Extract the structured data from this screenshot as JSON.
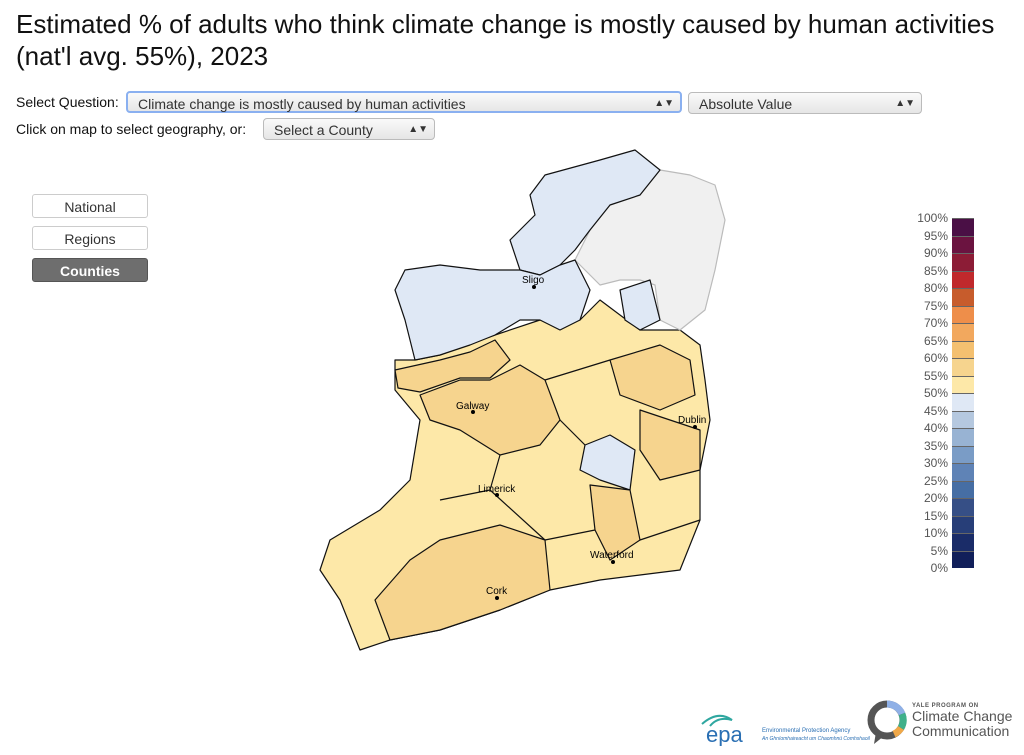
{
  "title": "Estimated % of adults who think climate change is mostly caused by human activities (nat'l avg. 55%), 2023",
  "controls": {
    "question_label": "Select Question:",
    "question_value": "Climate change is mostly caused by human activities",
    "measure_value": "Absolute Value",
    "geo_label": "Click on map to select geography, or:",
    "county_value": "Select a County"
  },
  "levels": [
    {
      "label": "National",
      "active": false
    },
    {
      "label": "Regions",
      "active": false
    },
    {
      "label": "Counties",
      "active": true
    }
  ],
  "legend": {
    "labels": [
      "100%",
      "95%",
      "90%",
      "85%",
      "80%",
      "75%",
      "70%",
      "65%",
      "60%",
      "55%",
      "50%",
      "45%",
      "40%",
      "35%",
      "30%",
      "25%",
      "20%",
      "15%",
      "10%",
      "5%",
      "0%"
    ],
    "colors": [
      "#4a0f45",
      "#6b1340",
      "#8c1c36",
      "#c0292c",
      "#c75c2c",
      "#ee8e4a",
      "#f2a85e",
      "#f4c070",
      "#f6d48e",
      "#fde8a8",
      "#dfe8f5",
      "#b5c8df",
      "#98b3d3",
      "#7a9cc6",
      "#5f83b6",
      "#466ea4",
      "#364f86",
      "#273e78",
      "#1a2c68",
      "#111f5a"
    ]
  },
  "cities": [
    {
      "name": "Sligo"
    },
    {
      "name": "Galway"
    },
    {
      "name": "Dublin"
    },
    {
      "name": "Limerick"
    },
    {
      "name": "Waterford"
    },
    {
      "name": "Cork"
    }
  ],
  "logos": {
    "epa": "epa",
    "epa_name": "Environmental Protection Agency",
    "epa_irish": "An Ghníomhaireacht um Chaomhnú Comhshaoil",
    "yale_small": "YALE PROGRAM ON",
    "yale_big1": "Climate Change",
    "yale_big2": "Communication"
  }
}
